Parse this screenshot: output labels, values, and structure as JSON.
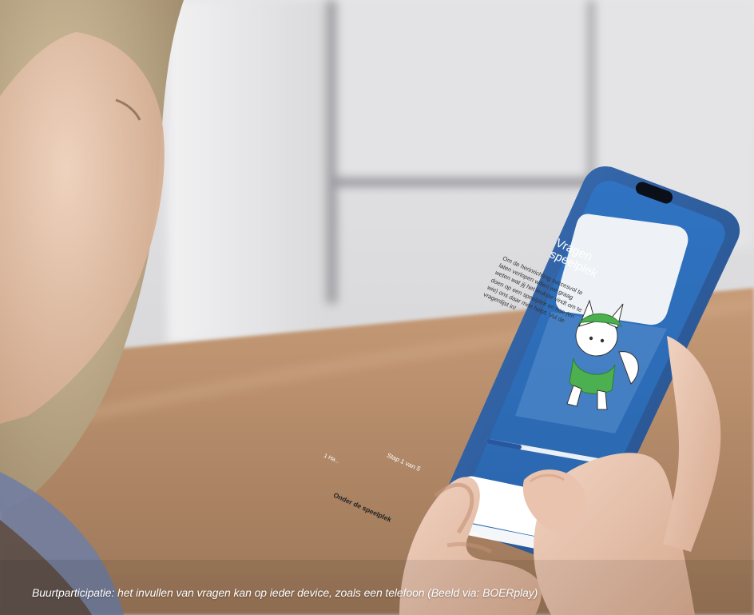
{
  "caption": "Buurtparticipatie: het invullen van vragen kan op ieder device, zoals een telefoon (Beeld via: BOERplay)",
  "phone_screen": {
    "title_line1": "Vragen",
    "title_line2": "speelplek",
    "card_text": "Om de herinrichting succesvol te laten verlopen willen we graag weten wat jij het leukste vindt om te doen op een speelplek en hoe (en wie) ons daar mee helpt. Vul de vragenlijst in!",
    "step_label": "Stap 1 van 5",
    "sub_label": "1 Ha...",
    "button_label": "Onder de speelplek"
  },
  "colors": {
    "phone_case": "#2c5fa3",
    "screen_bg": "#3a7cc9",
    "card_bg": "#f1f3f6",
    "floor": "#b58a66",
    "wall": "#d9d9dc"
  }
}
